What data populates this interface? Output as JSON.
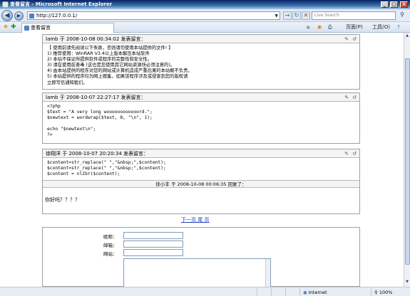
{
  "window": {
    "title": "查看留言 - Microsoft Internet Explorer",
    "buttons": [
      "_",
      "□",
      "×"
    ]
  },
  "address_bar": {
    "url": "http://127.0.0.1/",
    "search_placeholder": "Live Search"
  },
  "tab": {
    "label": "查看留言"
  },
  "command_bar": {
    "page_label": "页面(P)",
    "tools_label": "工具(O)"
  },
  "messages": [
    {
      "header": "lamb 于 2008-10-08 00:34:02 发表留言：",
      "lines": [
        "【 使用前请先阅读以下条款，否则请勿使用本站提供的文件! 】",
        "1) 推荐使用：WinRAR V3.4以上版本解压本站软件",
        "2) 本站不保证所提供软件或程序的完整性和安全性。",
        "3) 请在使用前查毒 (这也是您使用其它网站资源所必须注意的)。",
        "4) 由本站提供的程序对您的网站或计算机造成严重后果的本站概不负责。",
        "5) 本站提供的程序均为网上搜集，如果该程序涉及或侵害到您的版权请",
        "立即写信通知我们。"
      ]
    },
    {
      "header": "lamb 于 2008-10-07 22:27:17 发表留言：",
      "lines": [
        "<?php",
        "$text = \"A very long woooooooooooord.\";",
        "$newtext = wordwrap($text, 8, \"\\n\", 1);",
        "",
        "echo \"$newtext\\n\";",
        "?>"
      ]
    },
    {
      "header": "徐翔洋 于 2008-10-07 20:20:34 发表留言：",
      "lines": [
        "$content=str_replace(\" \",\"&nbsp;\",$content);",
        "$content=str_replace(\" \",\"&nbsp;\",$content);",
        "$content = nl2br($content);"
      ],
      "reply_header": "徐小丰 于 2008-10-08 00:06:35 回复了：",
      "reply_body": "你好吗？？？？"
    }
  ],
  "pager": "下一页 尾  页",
  "form": {
    "name_label": "昵称：",
    "email_label": "邮箱：",
    "site_label": "网站："
  },
  "status_bar": {
    "zone": "Internet",
    "zoom": "100%"
  }
}
